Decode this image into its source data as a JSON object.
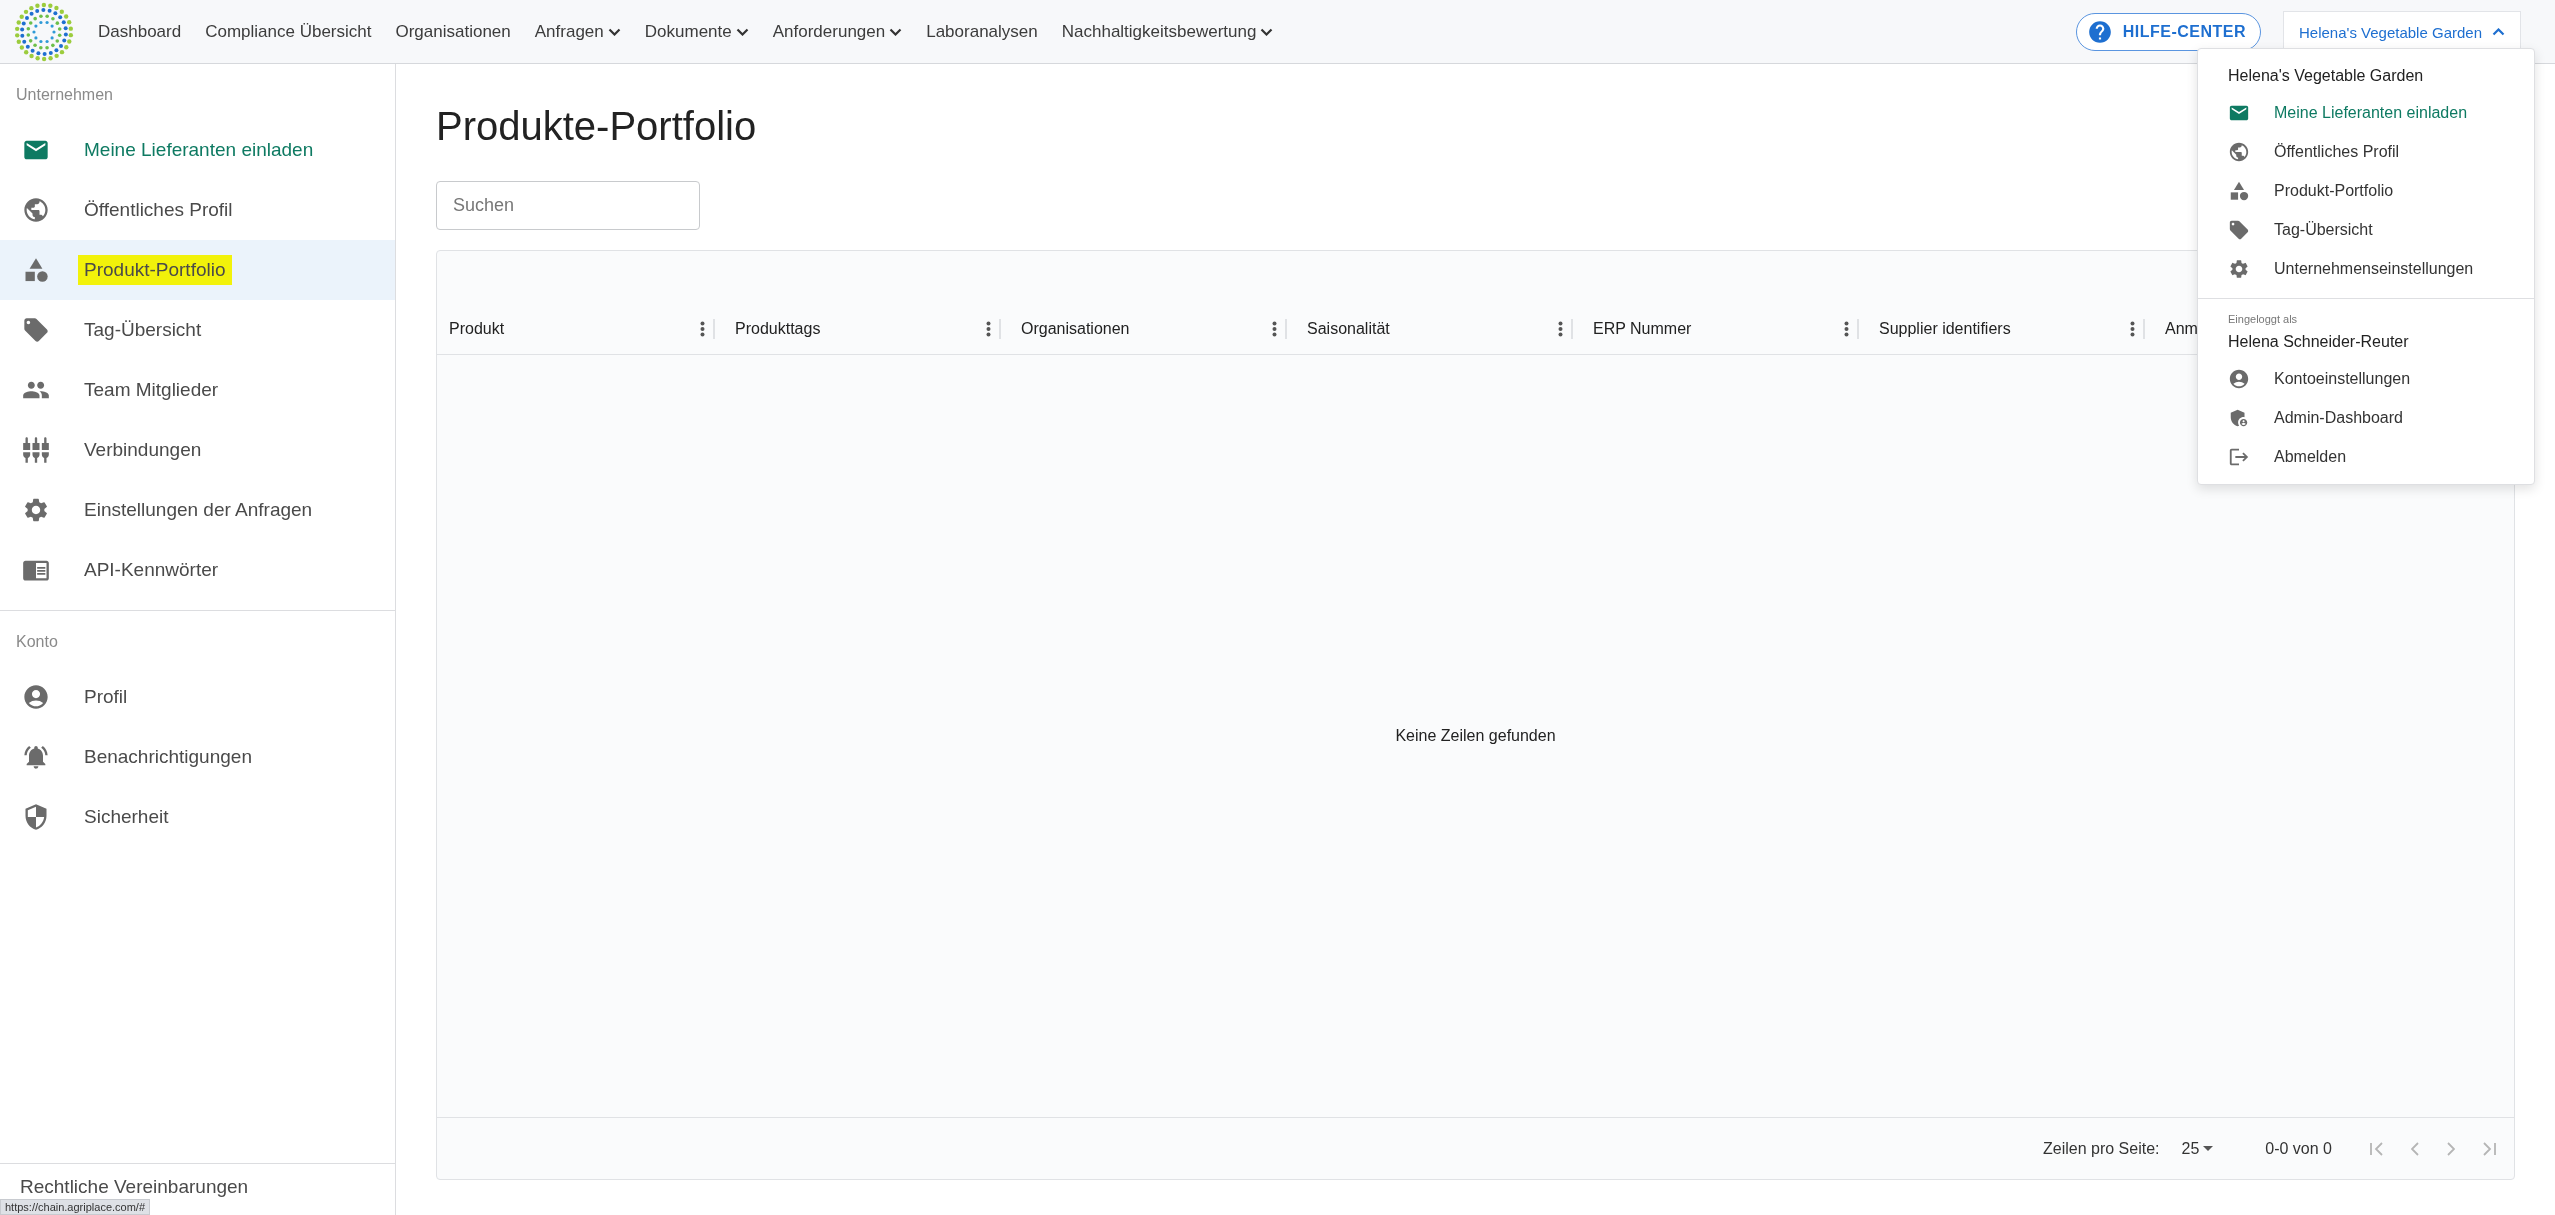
{
  "topbar": {
    "nav": [
      {
        "label": "Dashboard",
        "has_menu": false
      },
      {
        "label": "Compliance Übersicht",
        "has_menu": false
      },
      {
        "label": "Organisationen",
        "has_menu": false
      },
      {
        "label": "Anfragen",
        "has_menu": true
      },
      {
        "label": "Dokumente",
        "has_menu": true
      },
      {
        "label": "Anforderungen",
        "has_menu": true
      },
      {
        "label": "Laboranalysen",
        "has_menu": false
      },
      {
        "label": "Nachhaltigkeitsbewertung",
        "has_menu": true
      }
    ],
    "help_button": "HILFE-CENTER",
    "org_button": {
      "label": "Helena's Vegetable Garden",
      "expanded": true
    }
  },
  "sidebar": {
    "sections": [
      {
        "title": "Unternehmen",
        "items": [
          {
            "label": "Meine Lieferanten einladen",
            "selected": false,
            "accent": true,
            "highlighted": false
          },
          {
            "label": "Öffentliches Profil",
            "selected": false,
            "accent": false,
            "highlighted": false
          },
          {
            "label": "Produkt-Portfolio",
            "selected": true,
            "accent": false,
            "highlighted": true
          },
          {
            "label": "Tag-Übersicht",
            "selected": false,
            "accent": false,
            "highlighted": false
          },
          {
            "label": "Team Mitglieder",
            "selected": false,
            "accent": false,
            "highlighted": false
          },
          {
            "label": "Verbindungen",
            "selected": false,
            "accent": false,
            "highlighted": false
          },
          {
            "label": "Einstellungen der Anfragen",
            "selected": false,
            "accent": false,
            "highlighted": false
          },
          {
            "label": "API-Kennwörter",
            "selected": false,
            "accent": false,
            "highlighted": false
          }
        ]
      },
      {
        "title": "Konto",
        "items": [
          {
            "label": "Profil",
            "selected": false,
            "accent": false,
            "highlighted": false
          },
          {
            "label": "Benachrichtigungen",
            "selected": false,
            "accent": false,
            "highlighted": false
          },
          {
            "label": "Sicherheit",
            "selected": false,
            "accent": false,
            "highlighted": false
          }
        ]
      }
    ],
    "footer_link": "Rechtliche Vereinbarungen"
  },
  "page": {
    "title": "Produkte-Portfolio",
    "search": {
      "placeholder": "Suchen"
    },
    "table": {
      "columns": [
        "Produkt",
        "Produkttags",
        "Organisationen",
        "Saisonalität",
        "ERP Nummer",
        "Supplier identifiers",
        "Anm"
      ],
      "empty_message": "Keine Zeilen gefunden",
      "pagination": {
        "rows_label": "Zeilen pro Seite:",
        "rows_value": "25",
        "range": "0-0 von 0",
        "nav_disabled": true
      }
    }
  },
  "dropdown": {
    "org_name": "Helena's Vegetable Garden",
    "org_items": [
      {
        "label": "Meine Lieferanten einladen",
        "accent": true
      },
      {
        "label": "Öffentliches Profil",
        "accent": false
      },
      {
        "label": "Produkt-Portfolio",
        "accent": false
      },
      {
        "label": "Tag-Übersicht",
        "accent": false
      },
      {
        "label": "Unternehmenseinstellungen",
        "accent": false
      }
    ],
    "logged_in_label": "Eingeloggt als",
    "user_name": "Helena Schneider-Reuter",
    "user_items": [
      {
        "label": "Kontoeinstellungen"
      },
      {
        "label": "Admin-Dashboard"
      },
      {
        "label": "Abmelden"
      }
    ]
  },
  "status_url": "https://chain.agriplace.com/#"
}
